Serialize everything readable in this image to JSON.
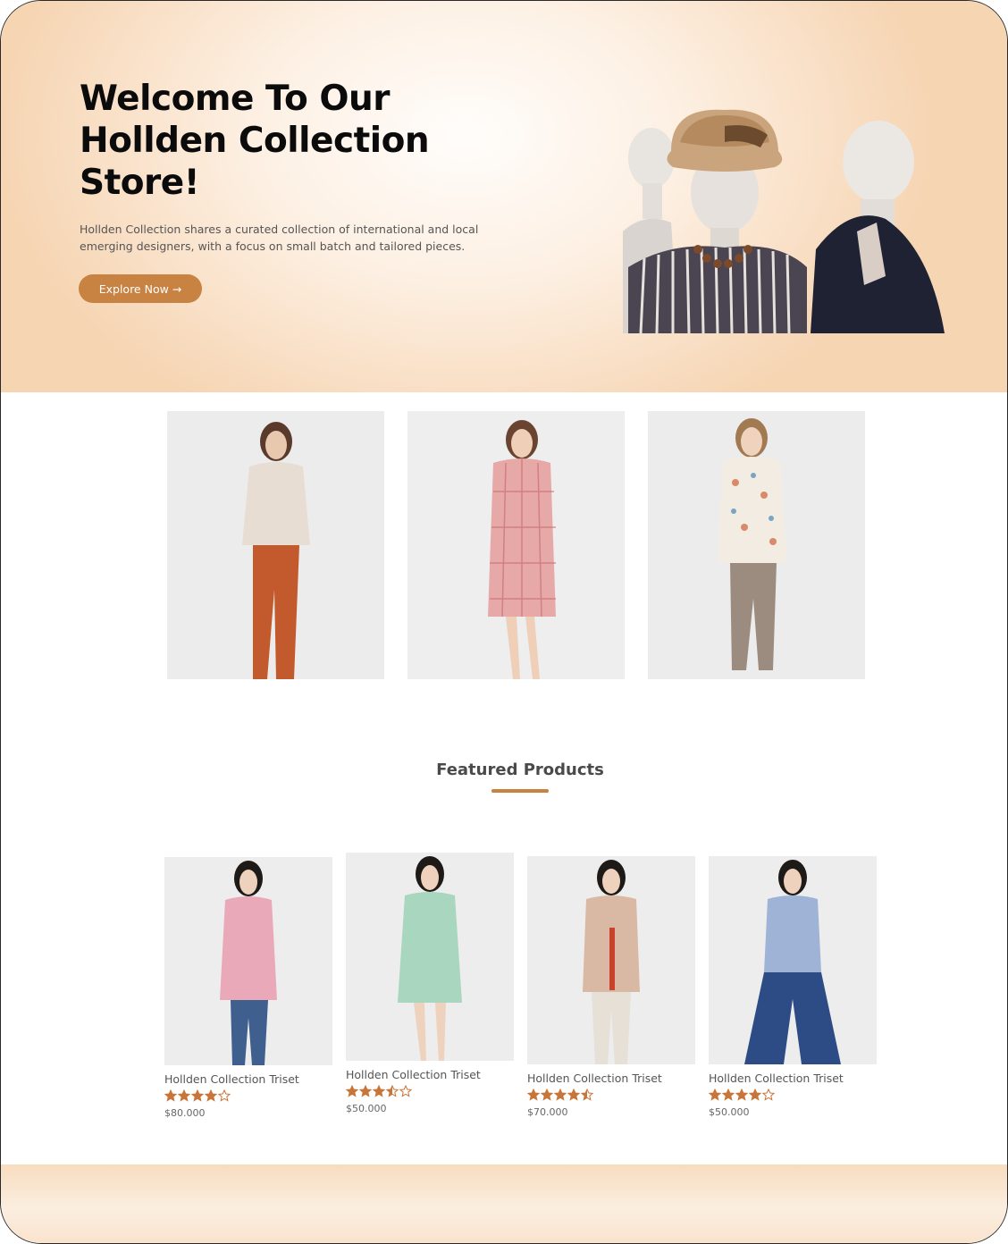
{
  "hero": {
    "title_line1": "Welcome To Our",
    "title_line2": "Hollden Collection",
    "title_line3": "Store!",
    "subtitle_line1": "Hollden Collection shares a curated collection of international and local",
    "subtitle_line2": "emerging designers, with a focus on small batch and tailored pieces.",
    "cta_label": "Explore Now →"
  },
  "featured": {
    "title": "Featured Products",
    "products": [
      {
        "name": "Hollden Collection Triset",
        "rating": 4,
        "price": "$80.000",
        "shirt_color": "#e9a9b8"
      },
      {
        "name": "Hollden Collection Triset",
        "rating": 3.5,
        "price": "$50.000",
        "shirt_color": "#a9d6be"
      },
      {
        "name": "Hollden Collection Triset",
        "rating": 4.5,
        "price": "$70.000",
        "shirt_color": "#d9b8a4"
      },
      {
        "name": "Hollden Collection Triset",
        "rating": 4,
        "price": "$50.000",
        "shirt_color": "#9fb3d6"
      }
    ]
  },
  "colors": {
    "accent": "#c88242",
    "hero_bg": "#f6d5b3",
    "star": "#c8753a"
  }
}
